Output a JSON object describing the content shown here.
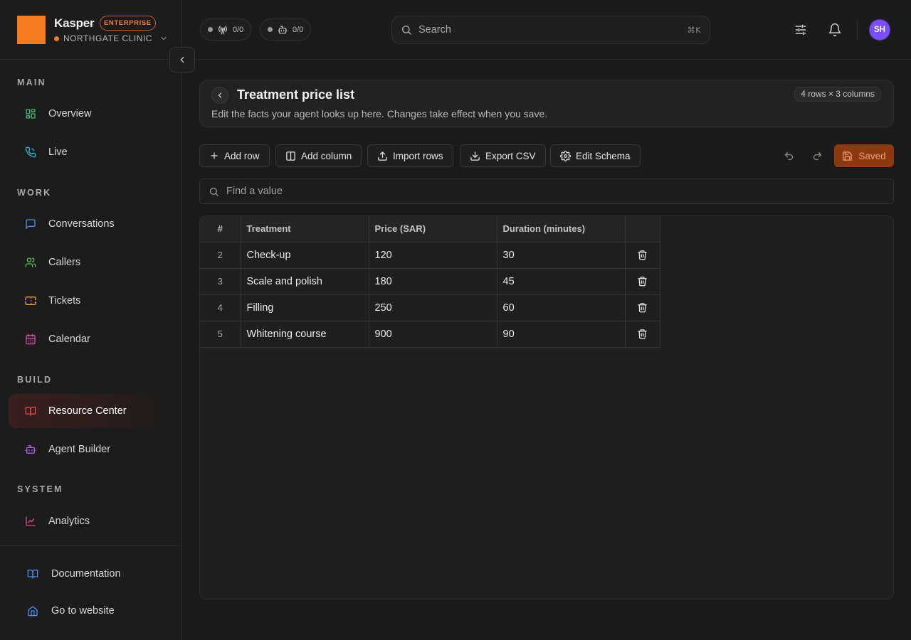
{
  "brand": {
    "name": "Kasper",
    "badge": "ENTERPRISE",
    "org": "NORTHGATE CLINIC",
    "accent": "#f47b20"
  },
  "status": [
    {
      "icon": "broadcast-icon",
      "value": "0/0"
    },
    {
      "icon": "bot-icon",
      "value": "0/0"
    }
  ],
  "search": {
    "placeholder": "Search",
    "shortcut": "⌘K"
  },
  "user": {
    "initials": "SH"
  },
  "nav": {
    "sections": [
      {
        "title": "MAIN",
        "items": [
          {
            "label": "Overview",
            "icon": "grid-icon",
            "color": "#3bbf7a"
          },
          {
            "label": "Live",
            "icon": "phone-icon",
            "color": "#2bb6d9"
          }
        ]
      },
      {
        "title": "WORK",
        "items": [
          {
            "label": "Conversations",
            "icon": "chat-icon",
            "color": "#4a8ff0"
          },
          {
            "label": "Callers",
            "icon": "users-icon",
            "color": "#5cc04a"
          },
          {
            "label": "Tickets",
            "icon": "ticket-icon",
            "color": "#f0a020"
          },
          {
            "label": "Calendar",
            "icon": "calendar-icon",
            "color": "#d94aa5"
          }
        ]
      },
      {
        "title": "BUILD",
        "items": [
          {
            "label": "Resource Center",
            "icon": "book-icon",
            "color": "#e04848",
            "active": true
          },
          {
            "label": "Agent Builder",
            "icon": "bot-icon",
            "color": "#b45af0"
          }
        ]
      },
      {
        "title": "SYSTEM",
        "items": [
          {
            "label": "Analytics",
            "icon": "chart-icon",
            "color": "#e0488a"
          }
        ]
      }
    ],
    "footer": [
      {
        "label": "Documentation",
        "icon": "book-open-icon",
        "color": "#4a8ff0"
      },
      {
        "label": "Go to website",
        "icon": "home-icon",
        "color": "#4a8ff0"
      }
    ]
  },
  "page": {
    "title": "Treatment price list",
    "subtitle": "Edit the facts your agent looks up here. Changes take effect when you save.",
    "dims": "4 rows × 3 columns"
  },
  "toolbar": {
    "add_row": "Add row",
    "add_column": "Add column",
    "import_rows": "Import rows",
    "export_csv": "Export CSV",
    "edit_schema": "Edit Schema",
    "saved": "Saved"
  },
  "find": {
    "placeholder": "Find a value"
  },
  "table": {
    "columns": [
      "#",
      "Treatment",
      "Price (SAR)",
      "Duration (minutes)"
    ],
    "rows": [
      {
        "num": "2",
        "treatment": "Check-up",
        "price": "120",
        "duration": "30"
      },
      {
        "num": "3",
        "treatment": "Scale and polish",
        "price": "180",
        "duration": "45"
      },
      {
        "num": "4",
        "treatment": "Filling",
        "price": "250",
        "duration": "60"
      },
      {
        "num": "5",
        "treatment": "Whitening course",
        "price": "900",
        "duration": "90"
      }
    ]
  }
}
